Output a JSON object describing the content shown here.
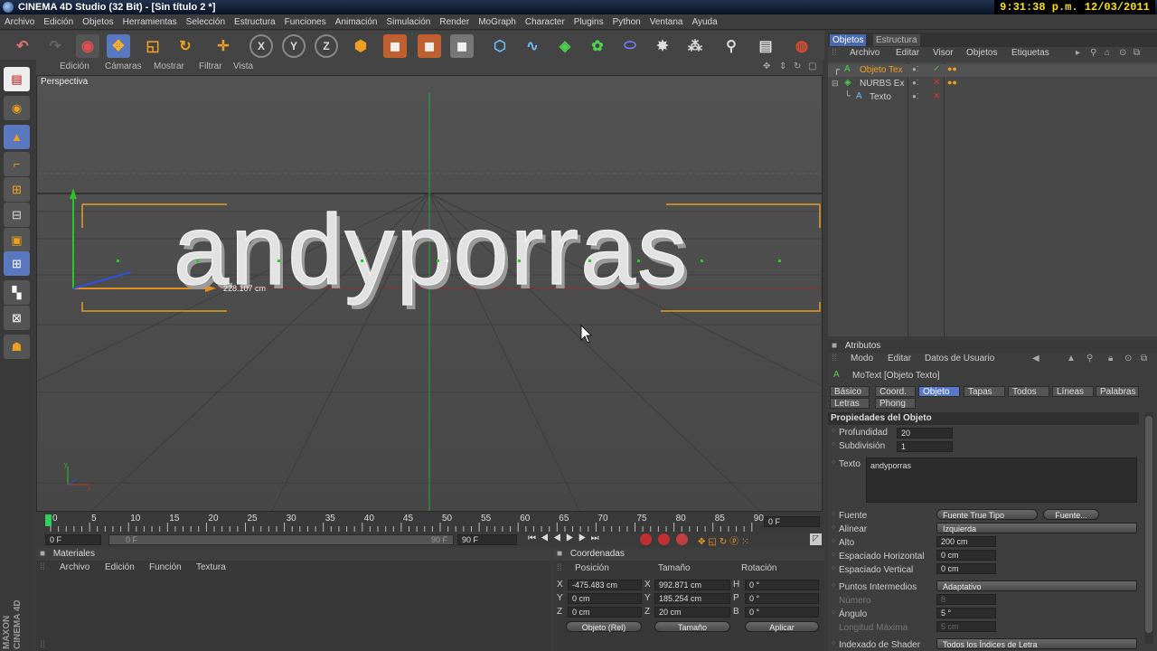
{
  "window": {
    "title": "CINEMA 4D Studio (32 Bit) - [Sin título 2 *]",
    "clock": "9:31:38 p.m. 12/03/2011"
  },
  "menu": [
    "Archivo",
    "Edición",
    "Objetos",
    "Herramientas",
    "Selección",
    "Estructura",
    "Funciones",
    "Animación",
    "Simulación",
    "Render",
    "MoGraph",
    "Character",
    "Plugins",
    "Python",
    "Ventana",
    "Ayuda"
  ],
  "viewport": {
    "menu": [
      "Edición",
      "Cámaras",
      "Mostrar",
      "Filtrar",
      "Vista"
    ],
    "label": "Perspectiva",
    "text3d": "andyporras",
    "measure": "228.107 cm"
  },
  "timeline": {
    "ticks": [
      "0",
      "5",
      "10",
      "15",
      "20",
      "25",
      "30",
      "35",
      "40",
      "45",
      "50",
      "55",
      "60",
      "65",
      "70",
      "75",
      "80",
      "85",
      "90"
    ],
    "current": "0 F",
    "start": "0 F",
    "range_start": "0 F",
    "range_end": "90 F",
    "end": "90 F"
  },
  "materials": {
    "title": "Materiales",
    "menu": [
      "Archivo",
      "Edición",
      "Función",
      "Textura"
    ]
  },
  "coords": {
    "title": "Coordenadas",
    "cols": [
      "Posición",
      "Tamaño",
      "Rotación"
    ],
    "rows": [
      {
        "axis": "X",
        "pos": "-475.483 cm",
        "size_axis": "X",
        "size": "992.871 cm",
        "rot_axis": "H",
        "rot": "0 °"
      },
      {
        "axis": "Y",
        "pos": "0 cm",
        "size_axis": "Y",
        "size": "185.254 cm",
        "rot_axis": "P",
        "rot": "0 °"
      },
      {
        "axis": "Z",
        "pos": "0 cm",
        "size_axis": "Z",
        "size": "20 cm",
        "rot_axis": "B",
        "rot": "0 °"
      }
    ],
    "mode": "Objeto (Rel)",
    "size_mode": "Tamaño",
    "apply": "Aplicar"
  },
  "objects": {
    "tabs": [
      "Objetos",
      "Estructura"
    ],
    "menu": [
      "Archivo",
      "Editar",
      "Visor",
      "Objetos",
      "Etiquetas"
    ],
    "items": [
      {
        "name": "Objeto Tex",
        "color": "#f0a020"
      },
      {
        "name": "NURBS Ex",
        "color": "#cfcfcf"
      },
      {
        "name": "Texto",
        "color": "#cfcfcf"
      }
    ]
  },
  "attributes": {
    "title": "Atributos",
    "menu": [
      "Modo",
      "Editar",
      "Datos de Usuario"
    ],
    "object": "MoText [Objeto Texto]",
    "tabs": [
      "Básico",
      "Coord.",
      "Objeto",
      "Tapas",
      "Todos",
      "Líneas",
      "Palabras",
      "Letras",
      "Phong"
    ],
    "section": "Propiedades del Objeto",
    "profundidad_label": "Profundidad",
    "profundidad": "20",
    "subdivision_label": "Subdivisión",
    "subdivision": "1",
    "texto_label": "Texto",
    "texto": "andyporras",
    "fuente_label": "Fuente",
    "fuente": "Fuente True Tipo",
    "fuente_btn": "Fuente...",
    "alinear_label": "Alinear",
    "alinear": "Izquierda",
    "alto_label": "Alto",
    "alto": "200 cm",
    "esp_h_label": "Espaciado Horizontal",
    "esp_h": "0 cm",
    "esp_v_label": "Espaciado Vertical",
    "esp_v": "0 cm",
    "puntos_label": "Puntos Intermedios",
    "puntos": "Adaptativo",
    "numero_label": "Número",
    "numero": "8",
    "angulo_label": "Ángulo",
    "angulo": "5 °",
    "longitud_label": "Longitud Máxima",
    "longitud": "5 cm",
    "indexado_label": "Indexado de Shader",
    "indexado": "Todos los Índices de Letra"
  },
  "brand": "MAXON CINEMA 4D"
}
